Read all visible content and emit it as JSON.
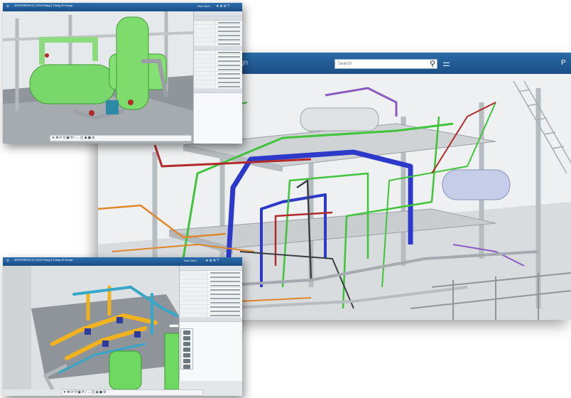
{
  "colors": {
    "titlebar_blue": "#1f5a96",
    "pipe_blue": "#2d39c9",
    "pipe_green": "#3fc43a",
    "pipe_red": "#b22a2a",
    "pipe_orange": "#e0862a",
    "pipe_yellow": "#f0b21d",
    "pipe_cyan": "#35a7c8",
    "pipe_purple": "#8a5bc2",
    "equipment_green": "#7cd86b",
    "structure_grey": "#c9cdd0"
  },
  "main_window": {
    "brand_fragment": "gn",
    "search": {
      "placeholder": "Search"
    },
    "icons": [
      "search-icon",
      "tag-icon"
    ],
    "right_fragment": "P"
  },
  "top_left_window": {
    "title": "3DEXPERIENCE | CATIA Piping & Tubing 3D Design",
    "user": "Mark Olsen"
  },
  "bottom_left_window": {
    "title": "3DEXPERIENCE | CATIA Piping & Tubing 3D Design",
    "user": "Mark Olsen"
  }
}
